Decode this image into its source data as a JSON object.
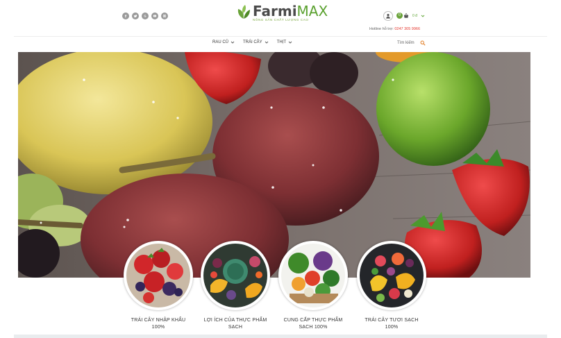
{
  "header": {
    "socials": [
      "facebook-icon",
      "twitter-icon",
      "google-icon",
      "youtube-icon",
      "instagram-icon"
    ],
    "logo": {
      "name": "Farmi",
      "suffix": "MAX",
      "tagline": "NÔNG SẢN CHẤT LƯỢNG CAO"
    },
    "cart": {
      "count": "0",
      "total": "0 đ"
    },
    "hotline": {
      "label": "Hotline hỗ trợ:",
      "number": "0247 305 9966"
    }
  },
  "nav": {
    "items": [
      "RAU CỦ",
      "TRÁI CÂY",
      "THỊT"
    ]
  },
  "search": {
    "placeholder": "Tìm kiếm"
  },
  "features": [
    {
      "line1": "TRÁI CÂY NHẬP KHẨU",
      "line2": "100%"
    },
    {
      "line1": "LỢI ÍCH CỦA THỰC PHẨM",
      "line2": "SẠCH"
    },
    {
      "line1": "CUNG CẤP THỰC PHẨM",
      "line2": "SẠCH 100%"
    },
    {
      "line1": "TRÁI CÂY TƯƠI SẠCH",
      "line2": "100%"
    }
  ],
  "colors": {
    "brand_green": "#5aa12f",
    "hotline_red": "#e5332a"
  }
}
